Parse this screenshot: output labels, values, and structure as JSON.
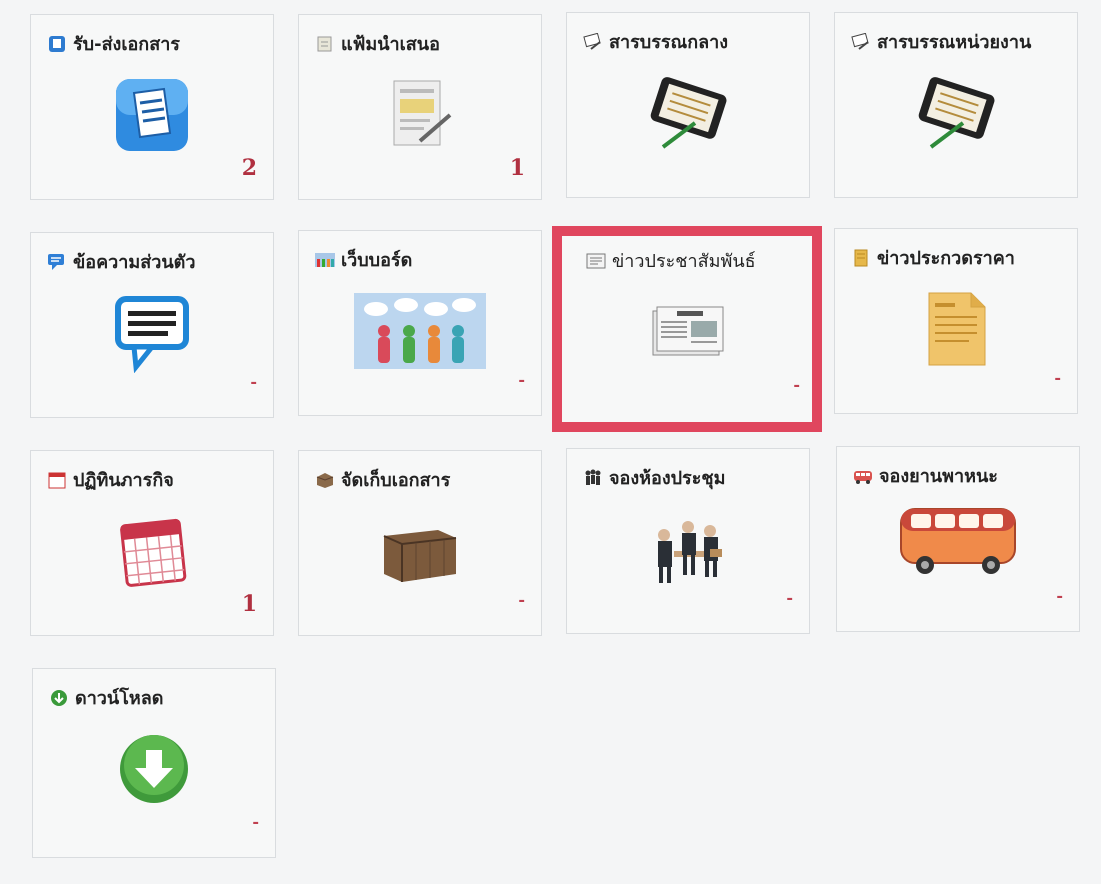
{
  "tiles": [
    {
      "id": "receive-send-docs",
      "label": "รับ-ส่งเอกสาร",
      "count": "2",
      "icon": "document-edit-icon",
      "small_icon": "document-small-icon"
    },
    {
      "id": "proposal-folder",
      "label": "แฟ้มนำเสนอ",
      "count": "1",
      "icon": "document-sign-icon",
      "small_icon": "folder-small-icon"
    },
    {
      "id": "central-correspondence",
      "label": "สารบรรณกลาง",
      "count": "",
      "icon": "tablet-pen-icon",
      "small_icon": "sign-small-icon"
    },
    {
      "id": "unit-correspondence",
      "label": "สารบรรณหน่วยงาน",
      "count": "",
      "icon": "tablet-pen-icon",
      "small_icon": "sign-small-icon"
    },
    {
      "id": "private-message",
      "label": "ข้อความส่วนตัว",
      "count": "-",
      "icon": "speech-bubble-icon",
      "small_icon": "chat-small-icon"
    },
    {
      "id": "webboard",
      "label": "เว็บบอร์ด",
      "count": "-",
      "icon": "people-chat-icon",
      "small_icon": "people-small-icon"
    },
    {
      "id": "pr-news",
      "label": "ข่าวประชาสัมพันธ์",
      "count": "-",
      "icon": "newspaper-icon",
      "small_icon": "newspaper-small-icon",
      "highlighted": true
    },
    {
      "id": "bid-news",
      "label": "ข่าวประกวดราคา",
      "count": "-",
      "icon": "notepad-icon",
      "small_icon": "notepad-small-icon"
    },
    {
      "id": "calendar",
      "label": "ปฏิทินภารกิจ",
      "count": "1",
      "icon": "calendar-icon",
      "small_icon": "calendar-small-icon"
    },
    {
      "id": "archive",
      "label": "จัดเก็บเอกสาร",
      "count": "-",
      "icon": "archive-box-icon",
      "small_icon": "box-small-icon"
    },
    {
      "id": "room-booking",
      "label": "จองห้องประชุม",
      "count": "-",
      "icon": "meeting-people-icon",
      "small_icon": "group-small-icon"
    },
    {
      "id": "vehicle-booking",
      "label": "จองยานพาหนะ",
      "count": "-",
      "icon": "bus-icon",
      "small_icon": "bus-small-icon"
    },
    {
      "id": "download",
      "label": "ดาวน์โหลด",
      "count": "-",
      "icon": "download-arrow-icon",
      "small_icon": "download-small-icon"
    }
  ],
  "colors": {
    "count": "#b03040",
    "highlight": "#e0465e",
    "tile_border": "#d9dcdf"
  }
}
